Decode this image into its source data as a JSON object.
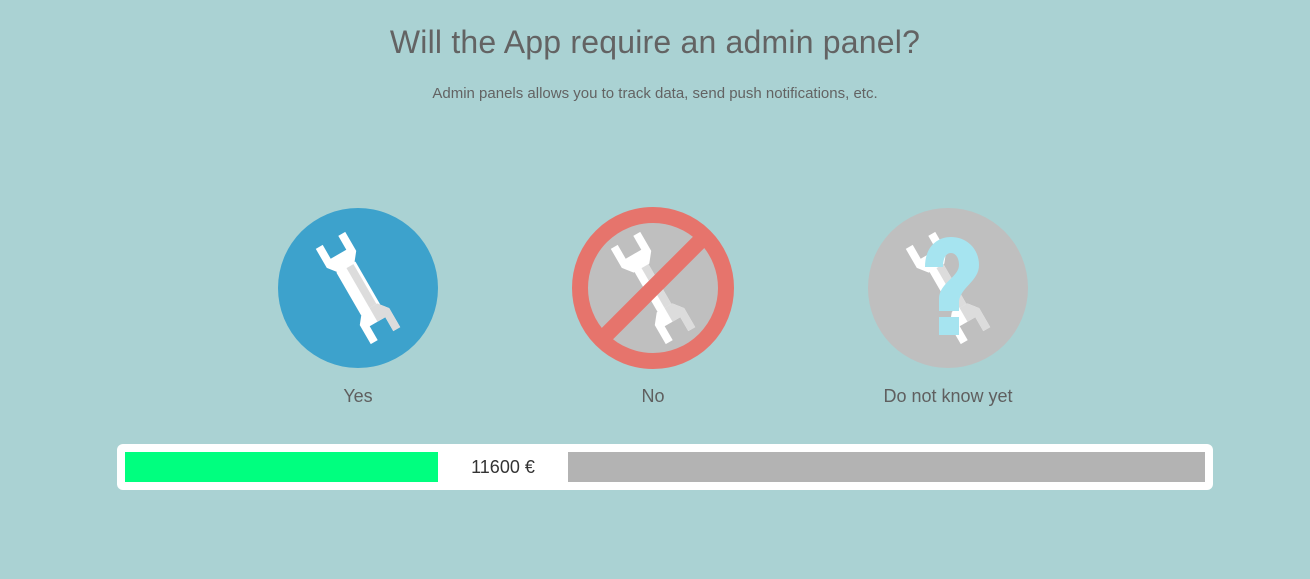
{
  "header": {
    "title": "Will the App require an admin panel?",
    "subtitle": "Admin panels allows you to track data, send push notifications, etc."
  },
  "options": [
    {
      "label": "Yes",
      "icon": "wrench-icon",
      "color": "#3da2cc"
    },
    {
      "label": "No",
      "icon": "no-wrench-icon",
      "color": "#e6746c"
    },
    {
      "label": "Do not know yet",
      "icon": "question-wrench-icon",
      "color": "#a6e4f0"
    }
  ],
  "price": {
    "amount": "11600 €",
    "progress_fraction": 0.29
  },
  "colors": {
    "background": "#aad2d3",
    "progress_fill": "#00ff7f",
    "progress_track": "#b3b3b3",
    "disabled_circle": "#bfbfbf"
  }
}
